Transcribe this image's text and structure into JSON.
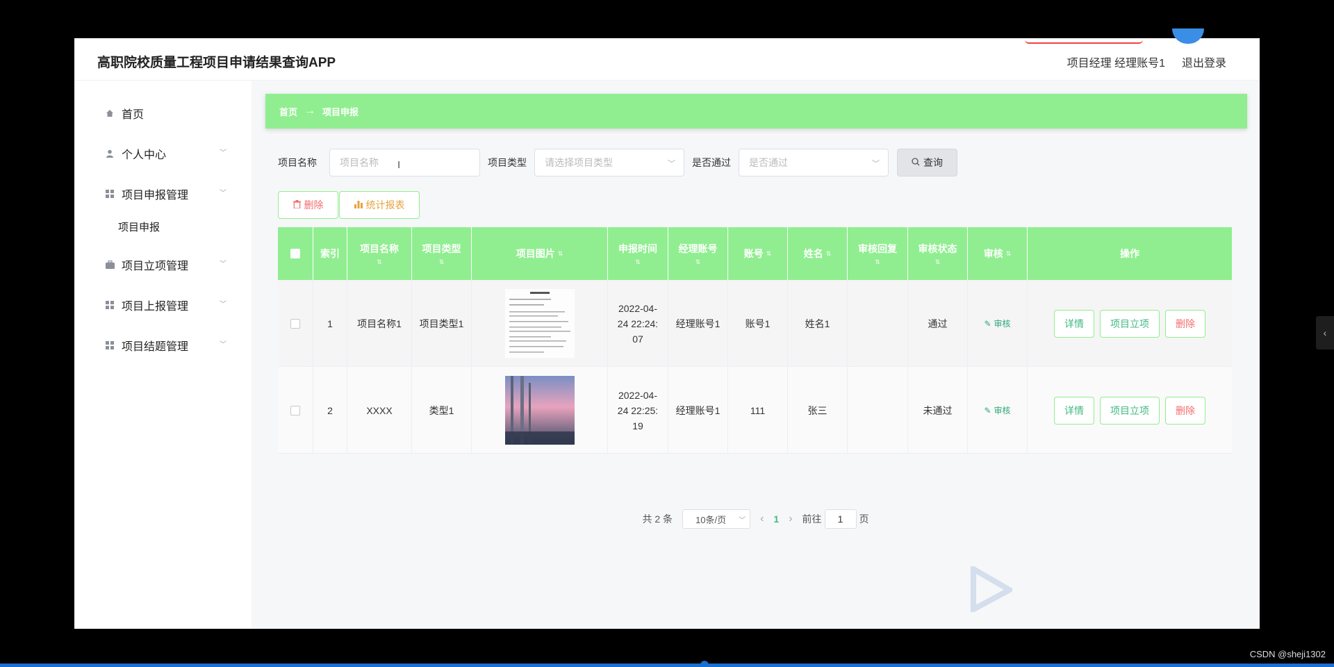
{
  "header": {
    "title": "高职院校质量工程项目申请结果查询APP",
    "user_label": "项目经理 经理账号1",
    "logout_label": "退出登录"
  },
  "sidebar": {
    "items": [
      {
        "label": "首页",
        "icon": "home-icon"
      },
      {
        "label": "个人中心",
        "icon": "user-icon"
      },
      {
        "label": "项目申报管理",
        "icon": "grid-icon"
      },
      {
        "label": "项目立项管理",
        "icon": "briefcase-icon"
      },
      {
        "label": "项目上报管理",
        "icon": "grid-icon"
      },
      {
        "label": "项目结题管理",
        "icon": "grid-icon"
      }
    ],
    "sub_item": "项目申报"
  },
  "breadcrumb": {
    "home": "首页",
    "arrow": "→",
    "current": "项目申报"
  },
  "filters": {
    "name_label": "项目名称",
    "name_placeholder": "项目名称",
    "type_label": "项目类型",
    "type_placeholder": "请选择项目类型",
    "pass_label": "是否通过",
    "pass_placeholder": "是否通过",
    "query_label": "查询"
  },
  "actions": {
    "delete_label": "删除",
    "stats_label": "统计报表"
  },
  "table": {
    "columns": [
      "索引",
      "项目名称",
      "项目类型",
      "项目图片",
      "申报时间",
      "经理账号",
      "账号",
      "姓名",
      "审核回复",
      "审核状态",
      "审核",
      "操作"
    ],
    "rows": [
      {
        "index": "1",
        "name": "项目名称1",
        "type": "项目类型1",
        "time_l1": "2022-04-",
        "time_l2": "24 22:24:",
        "time_l3": "07",
        "manager": "经理账号1",
        "account": "账号1",
        "person": "姓名1",
        "reply": "",
        "status": "通过",
        "audit": "审核"
      },
      {
        "index": "2",
        "name": "XXXX",
        "type": "类型1",
        "time_l1": "2022-04-",
        "time_l2": "24 22:25:",
        "time_l3": "19",
        "manager": "经理账号1",
        "account": "111",
        "person": "张三",
        "reply": "",
        "status": "未通过",
        "audit": "审核"
      }
    ],
    "op_detail": "详情",
    "op_approve": "项目立项",
    "op_delete": "删除"
  },
  "pagination": {
    "total": "共 2 条",
    "page_size": "10条/页",
    "current_page": "1",
    "goto_label": "前往",
    "goto_value": "1",
    "page_suffix": "页"
  },
  "footer": {
    "csdn": "CSDN @sheji1302"
  },
  "colors": {
    "accent": "#90ee90",
    "link": "#41b883",
    "danger": "#f56c6c",
    "warning": "#e6a23c"
  }
}
